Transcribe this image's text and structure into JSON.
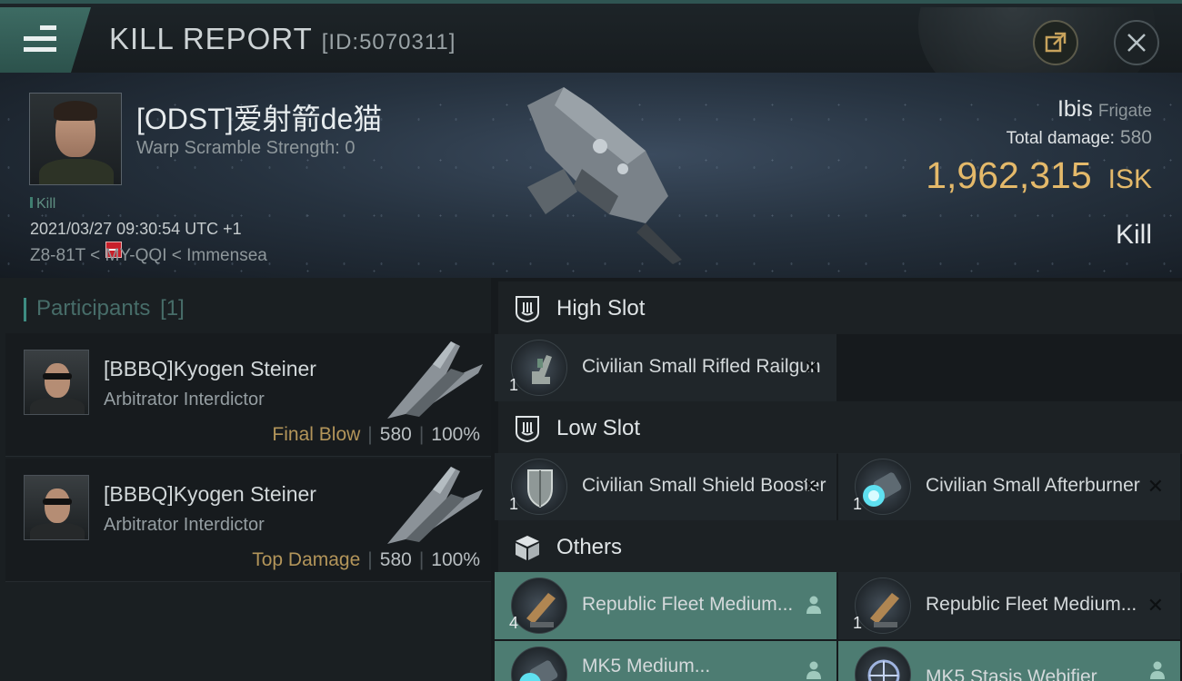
{
  "titlebar": {
    "title": "KILL REPORT",
    "report_id": "[ID:5070311]"
  },
  "victim": {
    "name": "[ODST]爱射箭de猫",
    "warp_scramble": "Warp Scramble Strength: 0",
    "kill_tag": "Kill",
    "datetime": "2021/03/27 09:30:54 UTC +1",
    "location": "Z8-81T < MY-QQI < Immensea"
  },
  "ship": {
    "name": "Ibis",
    "class": "Frigate",
    "total_damage_label": "Total damage:",
    "total_damage": "580",
    "isk_value": "1,962,315",
    "isk_unit": "ISK",
    "kill_type": "Kill"
  },
  "participants": {
    "header": "Participants",
    "count": "[1]",
    "rows": [
      {
        "name": "[BBBQ]Kyogen Steiner",
        "ship": "Arbitrator Interdictor",
        "role": "Final Blow",
        "damage": "580",
        "percent": "100%"
      },
      {
        "name": "[BBBQ]Kyogen Steiner",
        "ship": "Arbitrator Interdictor",
        "role": "Top Damage",
        "damage": "580",
        "percent": "100%"
      }
    ]
  },
  "slots": {
    "high": {
      "label": "High Slot",
      "items": [
        {
          "name": "Civilian Small Rifled Railgun",
          "qty": "1"
        }
      ]
    },
    "low": {
      "label": "Low Slot",
      "items": [
        {
          "name": "Civilian Small Shield Booster",
          "qty": "1"
        },
        {
          "name": "Civilian Small Afterburner",
          "qty": "1"
        }
      ]
    },
    "others": {
      "label": "Others",
      "items": [
        {
          "name": "Republic Fleet Medium...",
          "qty": "4"
        },
        {
          "name": "Republic Fleet Medium...",
          "qty": "1"
        },
        {
          "name": "MK5 Medium...",
          "qty": ""
        },
        {
          "name": "MK5 Stasis Webifier",
          "qty": ""
        }
      ]
    }
  },
  "colors": {
    "accent": "#3e8c82",
    "isk": "#e4b96a",
    "highlight_row": "#4d7c72",
    "danger": "#c8202a"
  }
}
